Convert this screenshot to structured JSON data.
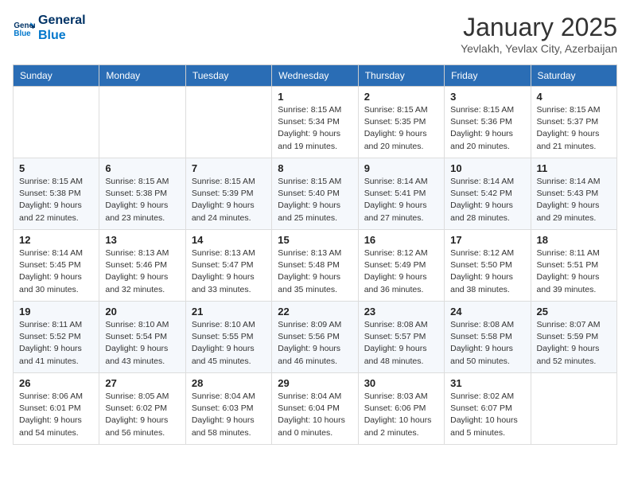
{
  "logo": {
    "line1": "General",
    "line2": "Blue"
  },
  "title": "January 2025",
  "subtitle": "Yevlakh, Yevlax City, Azerbaijan",
  "days_of_week": [
    "Sunday",
    "Monday",
    "Tuesday",
    "Wednesday",
    "Thursday",
    "Friday",
    "Saturday"
  ],
  "weeks": [
    [
      {
        "day": "",
        "info": ""
      },
      {
        "day": "",
        "info": ""
      },
      {
        "day": "",
        "info": ""
      },
      {
        "day": "1",
        "info": "Sunrise: 8:15 AM\nSunset: 5:34 PM\nDaylight: 9 hours\nand 19 minutes."
      },
      {
        "day": "2",
        "info": "Sunrise: 8:15 AM\nSunset: 5:35 PM\nDaylight: 9 hours\nand 20 minutes."
      },
      {
        "day": "3",
        "info": "Sunrise: 8:15 AM\nSunset: 5:36 PM\nDaylight: 9 hours\nand 20 minutes."
      },
      {
        "day": "4",
        "info": "Sunrise: 8:15 AM\nSunset: 5:37 PM\nDaylight: 9 hours\nand 21 minutes."
      }
    ],
    [
      {
        "day": "5",
        "info": "Sunrise: 8:15 AM\nSunset: 5:38 PM\nDaylight: 9 hours\nand 22 minutes."
      },
      {
        "day": "6",
        "info": "Sunrise: 8:15 AM\nSunset: 5:38 PM\nDaylight: 9 hours\nand 23 minutes."
      },
      {
        "day": "7",
        "info": "Sunrise: 8:15 AM\nSunset: 5:39 PM\nDaylight: 9 hours\nand 24 minutes."
      },
      {
        "day": "8",
        "info": "Sunrise: 8:15 AM\nSunset: 5:40 PM\nDaylight: 9 hours\nand 25 minutes."
      },
      {
        "day": "9",
        "info": "Sunrise: 8:14 AM\nSunset: 5:41 PM\nDaylight: 9 hours\nand 27 minutes."
      },
      {
        "day": "10",
        "info": "Sunrise: 8:14 AM\nSunset: 5:42 PM\nDaylight: 9 hours\nand 28 minutes."
      },
      {
        "day": "11",
        "info": "Sunrise: 8:14 AM\nSunset: 5:43 PM\nDaylight: 9 hours\nand 29 minutes."
      }
    ],
    [
      {
        "day": "12",
        "info": "Sunrise: 8:14 AM\nSunset: 5:45 PM\nDaylight: 9 hours\nand 30 minutes."
      },
      {
        "day": "13",
        "info": "Sunrise: 8:13 AM\nSunset: 5:46 PM\nDaylight: 9 hours\nand 32 minutes."
      },
      {
        "day": "14",
        "info": "Sunrise: 8:13 AM\nSunset: 5:47 PM\nDaylight: 9 hours\nand 33 minutes."
      },
      {
        "day": "15",
        "info": "Sunrise: 8:13 AM\nSunset: 5:48 PM\nDaylight: 9 hours\nand 35 minutes."
      },
      {
        "day": "16",
        "info": "Sunrise: 8:12 AM\nSunset: 5:49 PM\nDaylight: 9 hours\nand 36 minutes."
      },
      {
        "day": "17",
        "info": "Sunrise: 8:12 AM\nSunset: 5:50 PM\nDaylight: 9 hours\nand 38 minutes."
      },
      {
        "day": "18",
        "info": "Sunrise: 8:11 AM\nSunset: 5:51 PM\nDaylight: 9 hours\nand 39 minutes."
      }
    ],
    [
      {
        "day": "19",
        "info": "Sunrise: 8:11 AM\nSunset: 5:52 PM\nDaylight: 9 hours\nand 41 minutes."
      },
      {
        "day": "20",
        "info": "Sunrise: 8:10 AM\nSunset: 5:54 PM\nDaylight: 9 hours\nand 43 minutes."
      },
      {
        "day": "21",
        "info": "Sunrise: 8:10 AM\nSunset: 5:55 PM\nDaylight: 9 hours\nand 45 minutes."
      },
      {
        "day": "22",
        "info": "Sunrise: 8:09 AM\nSunset: 5:56 PM\nDaylight: 9 hours\nand 46 minutes."
      },
      {
        "day": "23",
        "info": "Sunrise: 8:08 AM\nSunset: 5:57 PM\nDaylight: 9 hours\nand 48 minutes."
      },
      {
        "day": "24",
        "info": "Sunrise: 8:08 AM\nSunset: 5:58 PM\nDaylight: 9 hours\nand 50 minutes."
      },
      {
        "day": "25",
        "info": "Sunrise: 8:07 AM\nSunset: 5:59 PM\nDaylight: 9 hours\nand 52 minutes."
      }
    ],
    [
      {
        "day": "26",
        "info": "Sunrise: 8:06 AM\nSunset: 6:01 PM\nDaylight: 9 hours\nand 54 minutes."
      },
      {
        "day": "27",
        "info": "Sunrise: 8:05 AM\nSunset: 6:02 PM\nDaylight: 9 hours\nand 56 minutes."
      },
      {
        "day": "28",
        "info": "Sunrise: 8:04 AM\nSunset: 6:03 PM\nDaylight: 9 hours\nand 58 minutes."
      },
      {
        "day": "29",
        "info": "Sunrise: 8:04 AM\nSunset: 6:04 PM\nDaylight: 10 hours\nand 0 minutes."
      },
      {
        "day": "30",
        "info": "Sunrise: 8:03 AM\nSunset: 6:06 PM\nDaylight: 10 hours\nand 2 minutes."
      },
      {
        "day": "31",
        "info": "Sunrise: 8:02 AM\nSunset: 6:07 PM\nDaylight: 10 hours\nand 5 minutes."
      },
      {
        "day": "",
        "info": ""
      }
    ]
  ]
}
